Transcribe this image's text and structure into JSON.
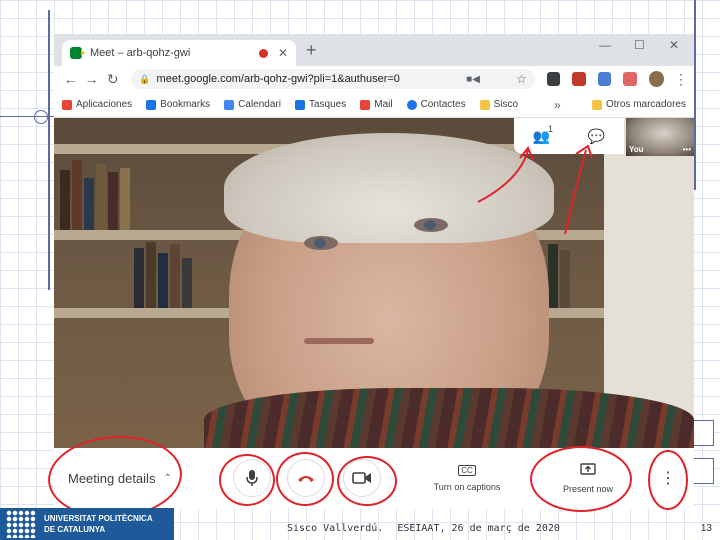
{
  "browser": {
    "tab_title": "Meet – arb-qohz-gwi",
    "tab_close": "✕",
    "new_tab": "+",
    "window_controls": [
      "—",
      "☐",
      "✕"
    ],
    "nav": [
      "←",
      "→",
      "↻"
    ],
    "url": "meet.google.com/arb-qohz-gwi?pli=1&authuser=0",
    "bookmarks": [
      "Aplicaciones",
      "Bookmarks",
      "Calendari",
      "Tasques",
      "Mail",
      "Contactes",
      "Sisco"
    ],
    "bookmarks_more": "»",
    "other_bookmarks": "Otros marcadores"
  },
  "meeting": {
    "participants_count": "1",
    "self_label": "You",
    "self_menu": "•••",
    "details_label": "Meeting details",
    "captions_label": "Turn on captions",
    "present_label": "Present now",
    "captions_icon": "CC"
  },
  "footer": {
    "logo_line1": "UNIVERSITAT POLITÈCNICA",
    "logo_line2": "DE CATALUNYA",
    "author": "Sisco Vallverdú.",
    "event": "ESEIAAT, 26 de març de 2020",
    "page": "13"
  },
  "colors": {
    "annotation_red": "#e0232a",
    "meet_green": "#00832d",
    "upc_blue": "#1e5a9a"
  }
}
